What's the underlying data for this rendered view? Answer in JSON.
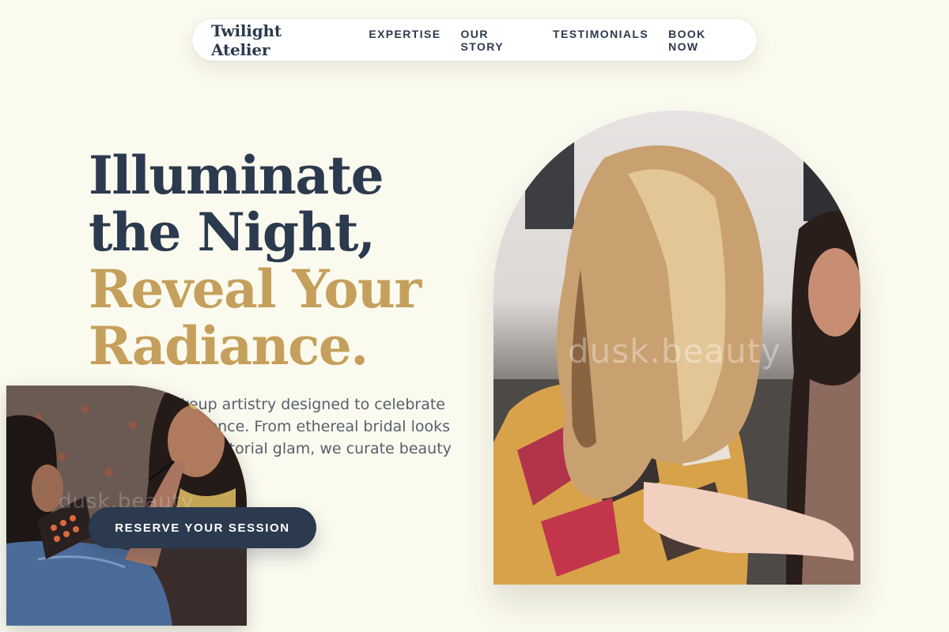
{
  "header": {
    "brand": "Twilight Atelier",
    "nav": [
      "EXPERTISE",
      "OUR STORY",
      "TESTIMONIALS",
      "BOOK NOW"
    ]
  },
  "hero": {
    "headline_line1": "Illuminate",
    "headline_line2": "the Night,",
    "headline_accent_line1": "Reveal Your",
    "headline_accent_line2": "Radiance.",
    "description": "Bespoke makeup artistry designed to celebrate your unique essence. From ethereal bridal looks to high-fashion editorial glam, we curate beauty that lasts.",
    "cta_label": "RESERVE YOUR SESSION"
  },
  "images": {
    "main_watermark": "dusk.beauty",
    "secondary_watermark": "dusk.beauty"
  },
  "colors": {
    "background": "#fbfaee",
    "navy": "#2b3a4e",
    "gold": "#c5a05c",
    "muted_text": "#56606e"
  }
}
